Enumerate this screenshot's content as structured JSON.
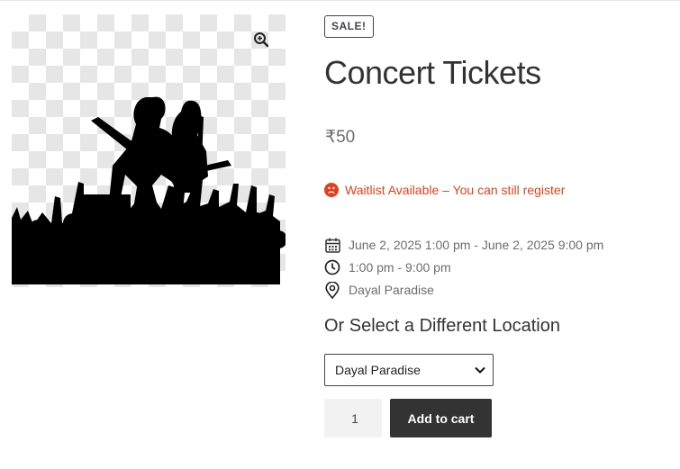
{
  "product": {
    "sale_badge": "SALE!",
    "title": "Concert Tickets",
    "price": "₹50",
    "image_icon": "concert-silhouette"
  },
  "zoom": {
    "icon": "magnifier-zoom-icon"
  },
  "waitlist": {
    "icon": "sad-face-icon",
    "text": "Waitlist Available – You can still register",
    "color": "#e2401c"
  },
  "event": {
    "date_icon": "calendar-icon",
    "dates": "June 2, 2025 1:00 pm - June 2, 2025 9:00 pm",
    "time_icon": "clock-icon",
    "time": "1:00 pm - 9:00 pm",
    "location_icon": "map-pin-icon",
    "location": "Dayal Paradise"
  },
  "location_select": {
    "heading": "Or Select a Different Location",
    "selected": "Dayal Paradise"
  },
  "cart": {
    "quantity": "1",
    "add_label": "Add to cart",
    "button_color": "#333333"
  }
}
